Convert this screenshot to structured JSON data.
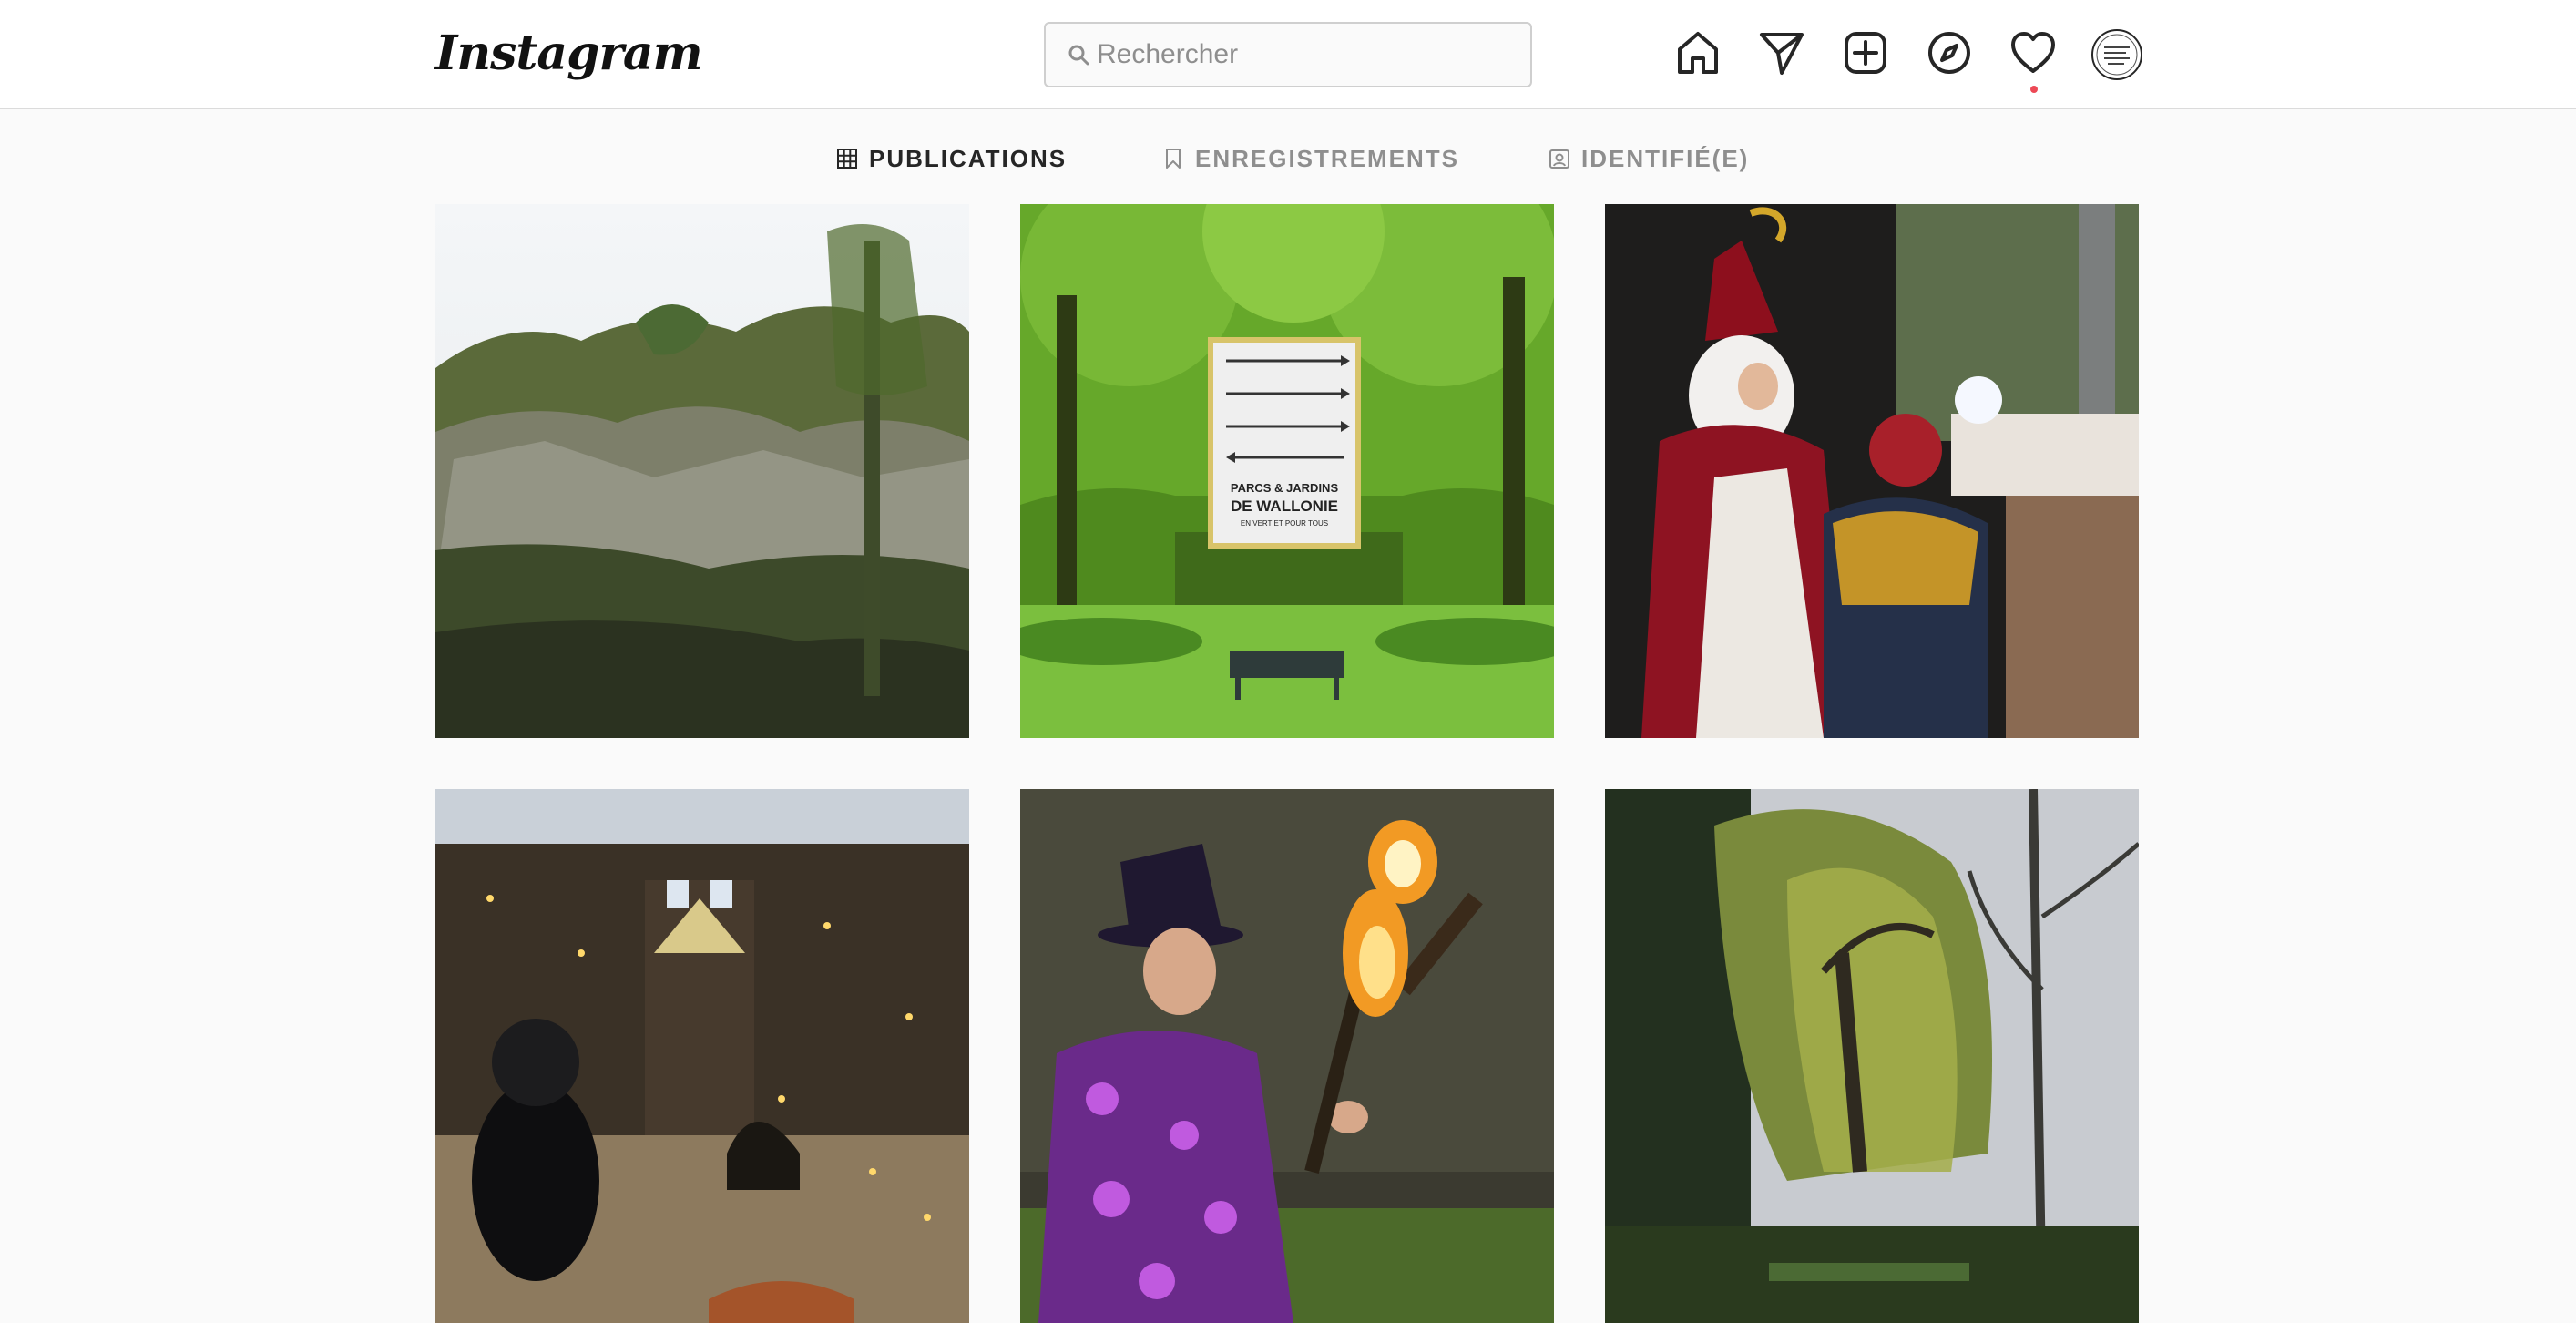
{
  "header": {
    "logo_text": "Instagram",
    "search": {
      "placeholder": "Rechercher",
      "value": ""
    },
    "icons": [
      "home-icon",
      "direct-icon",
      "new-post-icon",
      "explore-icon",
      "activity-icon",
      "avatar"
    ],
    "has_notification": true
  },
  "tabs": [
    {
      "label": "PUBLICATIONS",
      "icon": "grid-icon",
      "active": true
    },
    {
      "label": "ENREGISTREMENTS",
      "icon": "bookmark-icon",
      "active": false
    },
    {
      "label": "IDENTIFIÉ(E)",
      "icon": "tagged-icon",
      "active": false
    }
  ],
  "posts": [
    {
      "subject": "rocky-cliff-trees"
    },
    {
      "subject": "park-sign-bench",
      "sign_lines": [
        "PARCS & JARDINS",
        "DE WALLONIE",
        "EN VERT ET POUR TOUS"
      ]
    },
    {
      "subject": "saint-nicolas-child"
    },
    {
      "subject": "night-garden-lights"
    },
    {
      "subject": "fire-juggler"
    },
    {
      "subject": "willow-garden"
    }
  ],
  "colors": {
    "background": "#fafafa",
    "header_bg": "#ffffff",
    "border": "#dbdbdb",
    "text_primary": "#262626",
    "text_secondary": "#8e8e8e",
    "notification": "#ed4956"
  }
}
